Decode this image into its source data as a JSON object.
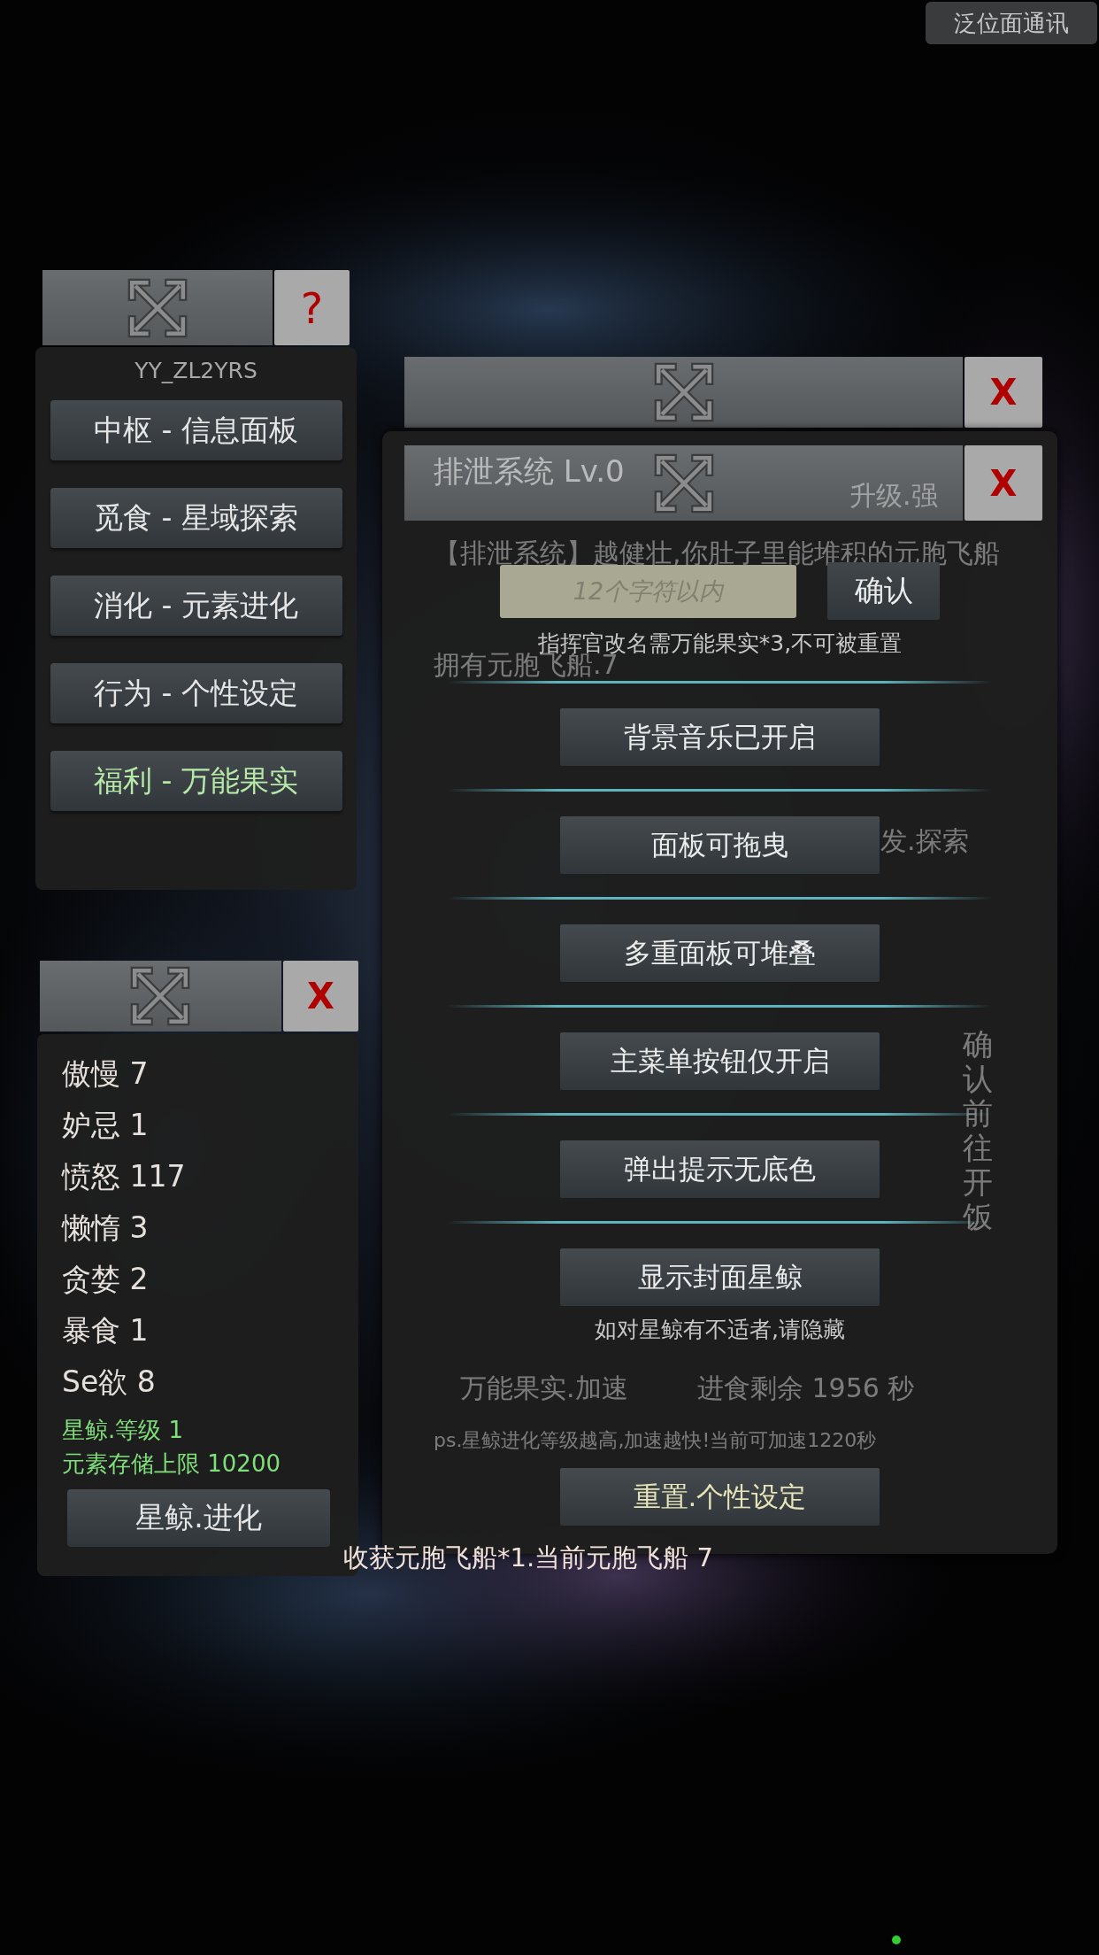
{
  "top_button": "泛位面通讯",
  "menu_panel": {
    "help_button": "?",
    "player_id": "YY_ZL2YRS",
    "items": [
      {
        "label": "中枢 - 信息面板",
        "kind": "normal"
      },
      {
        "label": "觅食 - 星域探索",
        "kind": "normal"
      },
      {
        "label": "消化 - 元素进化",
        "kind": "normal"
      },
      {
        "label": "行为 - 个性设定",
        "kind": "normal"
      },
      {
        "label": "福利 - 万能果实",
        "kind": "bonus"
      }
    ]
  },
  "stats_panel": {
    "close_button": "X",
    "stats": [
      "傲慢 7",
      "妒忌 1",
      "愤怒 117",
      "懒惰 3",
      "贪婪 2",
      "暴食 1",
      "Se欲 8"
    ],
    "info": [
      "星鲸.等级 1",
      "元素存储上限 10200"
    ],
    "evolve_button": "星鲸.进化"
  },
  "back_panel": {
    "close_button": "X"
  },
  "settings_panel": {
    "close_button": "X",
    "faded_texts": [
      {
        "text": "排泄系统 Lv.0",
        "kind": "title"
      },
      {
        "text": "升级.强",
        "kind": "line"
      },
      {
        "text": "【排泄系统】越健壮,你肚子里能堆积的元胞飞船",
        "kind": "line"
      },
      {
        "text": "拥有元胞飞船.7",
        "kind": "line"
      },
      {
        "text": "发.探索",
        "kind": "line"
      },
      {
        "text": "万能果实.加速",
        "kind": "line"
      },
      {
        "text": "进食剩余 1956 秒",
        "kind": "line"
      },
      {
        "text": "ps.星鲸进化等级越高,加速越快!当前可加速1220秒",
        "kind": "small"
      },
      {
        "text": "确认前往开饭",
        "kind": "vertical"
      }
    ],
    "name_field": {
      "placeholder": "12个字符以内"
    },
    "confirm_button": "确认",
    "rename_note": "指挥官改名需万能果实*3,不可被重置",
    "options": [
      {
        "label": "背景音乐已开启"
      },
      {
        "label": "面板可拖曳"
      },
      {
        "label": "多重面板可堆叠"
      },
      {
        "label": "主菜单按钮仅开启"
      },
      {
        "label": "弹出提示无底色"
      },
      {
        "label": "显示封面星鲸",
        "note": "如对星鲸有不适者,请隐藏"
      }
    ],
    "reset_button": "重置.个性设定"
  },
  "toast": "收获元胞飞船*1.当前元胞飞船 7"
}
